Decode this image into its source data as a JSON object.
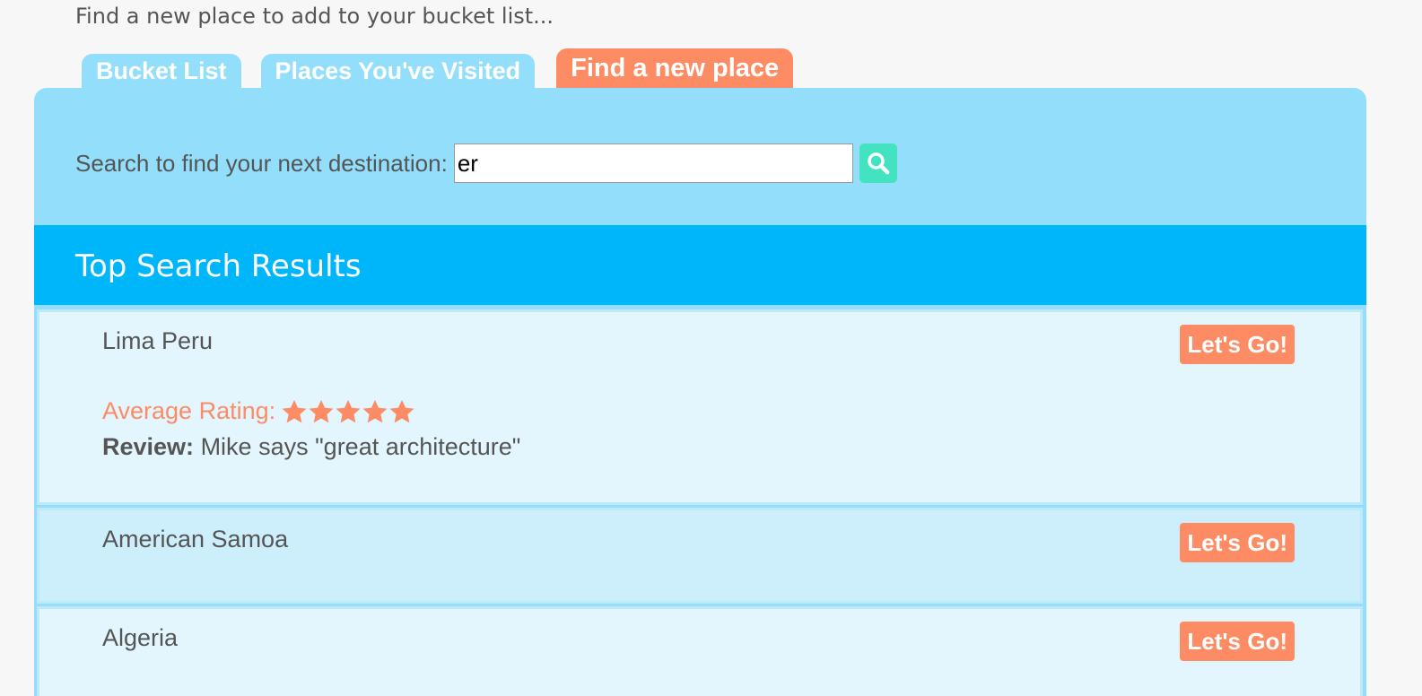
{
  "subtitle": "Find a new place to add to your bucket list...",
  "tabs": [
    {
      "label": "Bucket List",
      "active": false
    },
    {
      "label": "Places You've Visited",
      "active": false
    },
    {
      "label": "Find a new place",
      "active": true
    }
  ],
  "search": {
    "label": "Search to find your next destination:",
    "value": "er",
    "button_icon": "search-icon"
  },
  "results_title": "Top Search Results",
  "results": [
    {
      "name": "Lima Peru",
      "button_label": "Let's Go!",
      "rating_label": "Average Rating:",
      "rating": 5,
      "review_label": "Review:",
      "review_text": "Mike says \"great architecture\""
    },
    {
      "name": "American Samoa",
      "button_label": "Let's Go!"
    },
    {
      "name": "Algeria",
      "button_label": "Let's Go!"
    }
  ],
  "colors": {
    "tab": "#93dffb",
    "tab_active": "#fd8c65",
    "panel": "#93dffb",
    "header": "#00b6fb",
    "accent": "#fd8c65",
    "search_button": "#43e3c2"
  }
}
